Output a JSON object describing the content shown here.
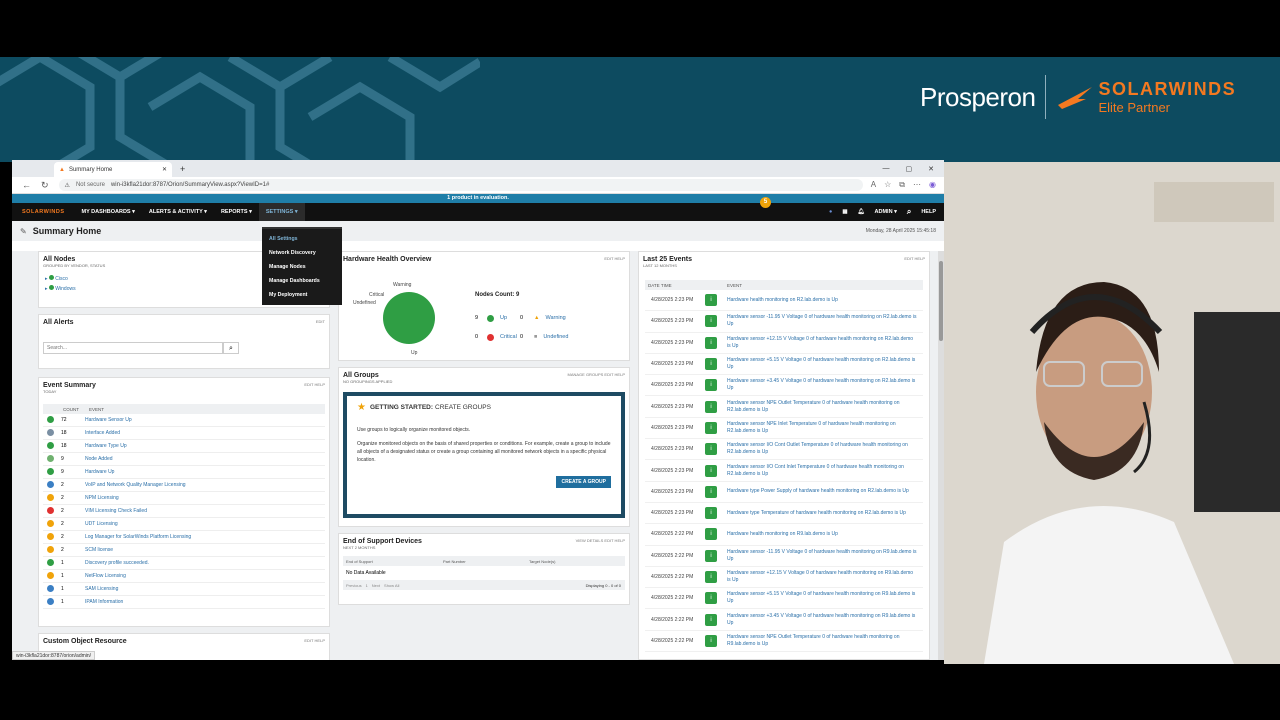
{
  "banner": {
    "brand_pros": "Prosperon",
    "brand_sw": "SOLARWINDS",
    "brand_partner": "Elite Partner"
  },
  "browser": {
    "tab_title": "Summary Home",
    "not_secure": "Not secure",
    "url": "win-i3kfla21dor:8787/Orion/SummaryView.aspx?ViewID=1#",
    "status_url": "win-i3kfla21dor:8787/orion/admin/"
  },
  "evalbar": "1 product in evaluation.",
  "nav": {
    "logo": "SOLARWINDS",
    "items": [
      "MY DASHBOARDS ▾",
      "ALERTS & ACTIVITY ▾",
      "REPORTS ▾",
      "SETTINGS ▾"
    ],
    "admin": "ADMIN ▾",
    "help": "HELP",
    "notif_count": "5"
  },
  "dropdown": [
    "All Settings",
    "Network Discovery",
    "Manage Nodes",
    "Manage Dashboards",
    "My Deployment"
  ],
  "page": {
    "title": "Summary Home",
    "date": "Monday, 28 April 2025 15:45:18"
  },
  "all_nodes": {
    "title": "All Nodes",
    "sub": "GROUPED BY VENDOR, STATUS",
    "items": [
      "Cisco",
      "Windows"
    ]
  },
  "all_alerts": {
    "title": "All Alerts",
    "edit": "EDIT",
    "search_placeholder": "Search..."
  },
  "event_summary": {
    "title": "Event Summary",
    "edit": "EDIT HELP",
    "sub": "TODAY",
    "col_count": "COUNT",
    "col_event": "EVENT",
    "rows": [
      {
        "count": "72",
        "label": "Hardware Sensor Up",
        "color": "#2f9e44"
      },
      {
        "count": "18",
        "label": "Interface Added",
        "color": "#7a8fa3"
      },
      {
        "count": "18",
        "label": "Hardware Type Up",
        "color": "#2f9e44"
      },
      {
        "count": "9",
        "label": "Node Added",
        "color": "#6fb16f"
      },
      {
        "count": "9",
        "label": "Hardware Up",
        "color": "#2f9e44"
      },
      {
        "count": "2",
        "label": "VoIP and Network Quality Manager Licensing",
        "color": "#3b7fc4"
      },
      {
        "count": "2",
        "label": "NPM Licensing",
        "color": "#f0a30a"
      },
      {
        "count": "2",
        "label": "VIM Licensing Check Failed",
        "color": "#e03131"
      },
      {
        "count": "2",
        "label": "UDT Licensing",
        "color": "#f0a30a"
      },
      {
        "count": "2",
        "label": "Log Manager for SolarWinds Platform Licensing",
        "color": "#f0a30a"
      },
      {
        "count": "2",
        "label": "SCM license",
        "color": "#f0a30a"
      },
      {
        "count": "1",
        "label": "Discovery profile succeeded.",
        "color": "#2f9e44"
      },
      {
        "count": "1",
        "label": "NetFlow Licensing",
        "color": "#f0a30a"
      },
      {
        "count": "1",
        "label": "SAM Licensing",
        "color": "#3b7fc4"
      },
      {
        "count": "1",
        "label": "IPAM Information",
        "color": "#3b7fc4"
      }
    ]
  },
  "custom_object": {
    "title": "Custom Object Resource",
    "edit": "EDIT HELP"
  },
  "hw_health": {
    "title": "Hardware Health Overview",
    "edit": "EDIT HELP",
    "labels": {
      "warning": "Warning",
      "critical": "Critical",
      "undefined": "Undefined",
      "up": "Up"
    },
    "nodes_count": "Nodes Count: 9",
    "up_n": "9",
    "up": "Up",
    "warn_n": "0",
    "warn": "Warning",
    "crit_n": "0",
    "crit": "Critical",
    "undef_n": "0",
    "undef": "Undefined"
  },
  "all_groups": {
    "title": "All Groups",
    "sub": "NO GROUPINGS APPLIED",
    "edit": "MANAGE GROUPS  EDIT  HELP",
    "gs_title": "GETTING STARTED:",
    "gs_title2": "CREATE GROUPS",
    "gs_p1": "Use groups to logically organize monitored objects.",
    "gs_p2": "Organize monitored objects on the basis of shared properties or conditions. For example, create a group to include all objects of a designated status or create a group containing all monitored network objects in a specific physical location.",
    "btn": "CREATE A GROUP"
  },
  "eos": {
    "title": "End of Support Devices",
    "sub": "NEXT 2 MONTHS",
    "edit": "VIEW DETAILS  EDIT  HELP",
    "cols": [
      "End of Support",
      "Part Number",
      "Target Node(s)"
    ],
    "empty": "No Data Available",
    "prev": "Previous",
    "next": "Next",
    "showall": "Show All",
    "displaying": "Displaying 0 - 0 of 0",
    "page": "1"
  },
  "events": {
    "title": "Last 25 Events",
    "sub": "LAST 12 MONTHS",
    "edit": "EDIT HELP",
    "col_dt": "DATE TIME",
    "col_ev": "EVENT",
    "rows": [
      {
        "dt": "4/28/2025 2:23 PM",
        "tx": "Hardware health monitoring on R2.lab.demo is Up"
      },
      {
        "dt": "4/28/2025 2:23 PM",
        "tx": "Hardware sensor -11.95 V Voltage 0 of hardware health monitoring on R2.lab.demo is Up"
      },
      {
        "dt": "4/28/2025 2:23 PM",
        "tx": "Hardware sensor +12.15 V Voltage 0 of hardware health monitoring on R2.lab.demo is Up"
      },
      {
        "dt": "4/28/2025 2:23 PM",
        "tx": "Hardware sensor +5.15 V Voltage 0 of hardware health monitoring on R2.lab.demo is Up"
      },
      {
        "dt": "4/28/2025 2:23 PM",
        "tx": "Hardware sensor +3.45 V Voltage 0 of hardware health monitoring on R2.lab.demo is Up"
      },
      {
        "dt": "4/28/2025 2:23 PM",
        "tx": "Hardware sensor NPE Outlet Temperature 0 of hardware health monitoring on R2.lab.demo is Up"
      },
      {
        "dt": "4/28/2025 2:23 PM",
        "tx": "Hardware sensor NPE Inlet Temperature 0 of hardware health monitoring on R2.lab.demo is Up"
      },
      {
        "dt": "4/28/2025 2:23 PM",
        "tx": "Hardware sensor I/O Cont Outlet Temperature 0 of hardware health monitoring on R2.lab.demo is Up"
      },
      {
        "dt": "4/28/2025 2:23 PM",
        "tx": "Hardware sensor I/O Cont Inlet Temperature 0 of hardware health monitoring on R2.lab.demo is Up"
      },
      {
        "dt": "4/28/2025 2:23 PM",
        "tx": "Hardware type Power Supply of hardware health monitoring on R2.lab.demo is Up"
      },
      {
        "dt": "4/28/2025 2:23 PM",
        "tx": "Hardware type Temperature of hardware health monitoring on R2.lab.demo is Up"
      },
      {
        "dt": "4/28/2025 2:22 PM",
        "tx": "Hardware health monitoring on R9.lab.demo is Up"
      },
      {
        "dt": "4/28/2025 2:22 PM",
        "tx": "Hardware sensor -11.95 V Voltage 0 of hardware health monitoring on R9.lab.demo is Up"
      },
      {
        "dt": "4/28/2025 2:22 PM",
        "tx": "Hardware sensor +12.15 V Voltage 0 of hardware health monitoring on R9.lab.demo is Up"
      },
      {
        "dt": "4/28/2025 2:22 PM",
        "tx": "Hardware sensor +5.15 V Voltage 0 of hardware health monitoring on R9.lab.demo is Up"
      },
      {
        "dt": "4/28/2025 2:22 PM",
        "tx": "Hardware sensor +3.45 V Voltage 0 of hardware health monitoring on R9.lab.demo is Up"
      },
      {
        "dt": "4/28/2025 2:22 PM",
        "tx": "Hardware sensor NPE Outlet Temperature 0 of hardware health monitoring on R9.lab.demo is Up"
      }
    ]
  }
}
